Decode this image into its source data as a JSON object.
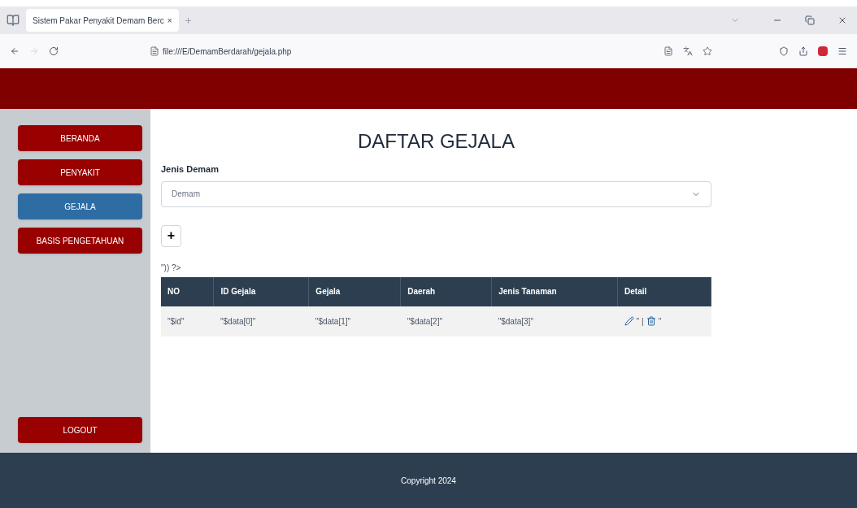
{
  "browser": {
    "tab_title": "Sistem Pakar Penyakit Demam Berc",
    "tab_close": "×",
    "new_tab": "+",
    "url": "file:///E/DemamBerdarah/gejala.php"
  },
  "sidebar": {
    "items": [
      {
        "label": "BERANDA",
        "selected": false
      },
      {
        "label": "PENYAKIT",
        "selected": false
      },
      {
        "label": "GEJALA",
        "selected": true
      },
      {
        "label": "BASIS PENGETAHUAN",
        "selected": false
      }
    ],
    "logout": "LOGOUT"
  },
  "title": "DAFTAR GEJALA",
  "filter": {
    "label": "Jenis Demam",
    "value": "Demam"
  },
  "add_button": "+",
  "stray_text": "\")) ?>",
  "table": {
    "columns": [
      "NO",
      "ID Gejala",
      "Gejala",
      "Daerah",
      "Jenis Tanaman",
      "Detail"
    ],
    "rows": [
      {
        "cells": [
          "\"$id\"",
          "\"$data[0]\"",
          "\"$data[1]\"",
          "\"$data[2]\"",
          "\"$data[3]\""
        ],
        "detail_texts": [
          "\"",
          "|",
          "\""
        ]
      }
    ]
  },
  "footer": "Copyright 2024"
}
